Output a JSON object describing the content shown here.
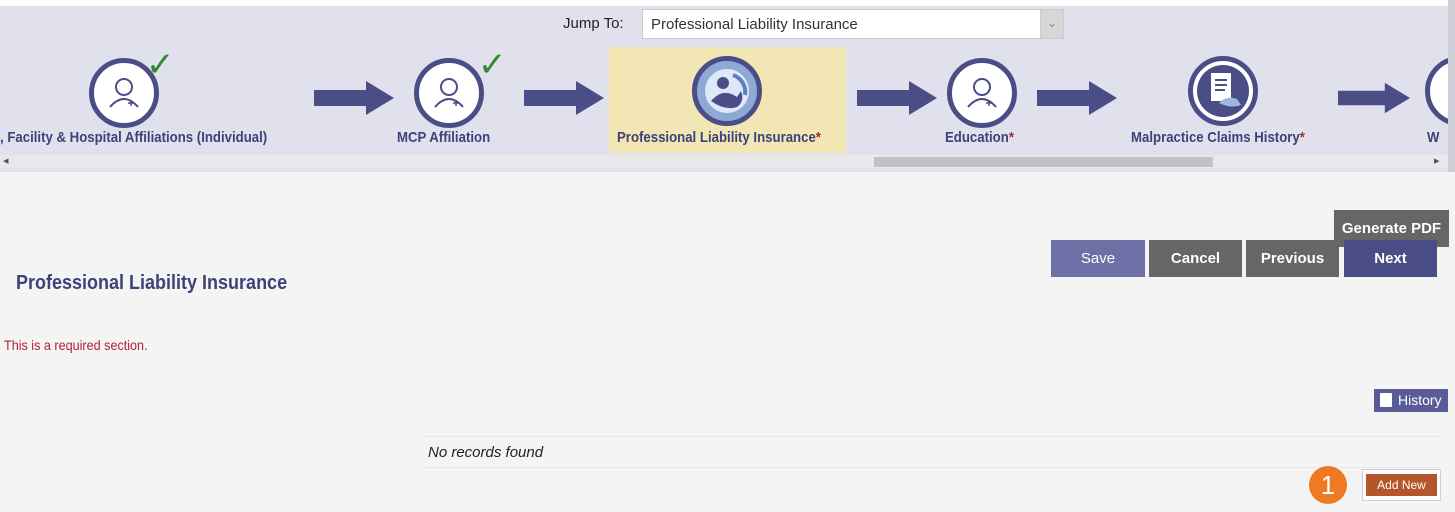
{
  "jump_to": {
    "label": "Jump To:",
    "selected": "Professional Liability Insurance"
  },
  "steps": [
    {
      "label": ", Facility & Hospital Affiliations (Individual)",
      "required": "",
      "completed": true,
      "icon": "provider-icon"
    },
    {
      "label": "MCP Affiliation",
      "required": "",
      "completed": true,
      "icon": "provider-icon"
    },
    {
      "label": "Professional Liability Insurance",
      "required": "*",
      "completed": false,
      "active": true,
      "icon": "insurance-icon"
    },
    {
      "label": "Education",
      "required": "*",
      "completed": false,
      "icon": "provider-icon"
    },
    {
      "label": "Malpractice Claims History",
      "required": "*",
      "completed": false,
      "icon": "handshake-document-icon"
    },
    {
      "label": "W",
      "required": "",
      "completed": false,
      "icon": "partial-icon"
    }
  ],
  "check_glyph": "✓",
  "scroll_glyphs": {
    "left": "◂",
    "right": "▸",
    "caret": "⌄"
  },
  "buttons": {
    "generate_pdf": "Generate PDF",
    "save": "Save",
    "cancel": "Cancel",
    "previous": "Previous",
    "next": "Next",
    "history": "History",
    "add_new": "Add New"
  },
  "section": {
    "title": "Professional Liability Insurance",
    "required_message": "This is a required section.",
    "empty_message": "No records found"
  },
  "badge": "1",
  "colors": {
    "primary": "#4b4d86",
    "highlight": "#f2e6b4",
    "required": "#b0233a",
    "check": "#2e8b2e",
    "add_new": "#b4562a",
    "badge": "#f07a24"
  }
}
